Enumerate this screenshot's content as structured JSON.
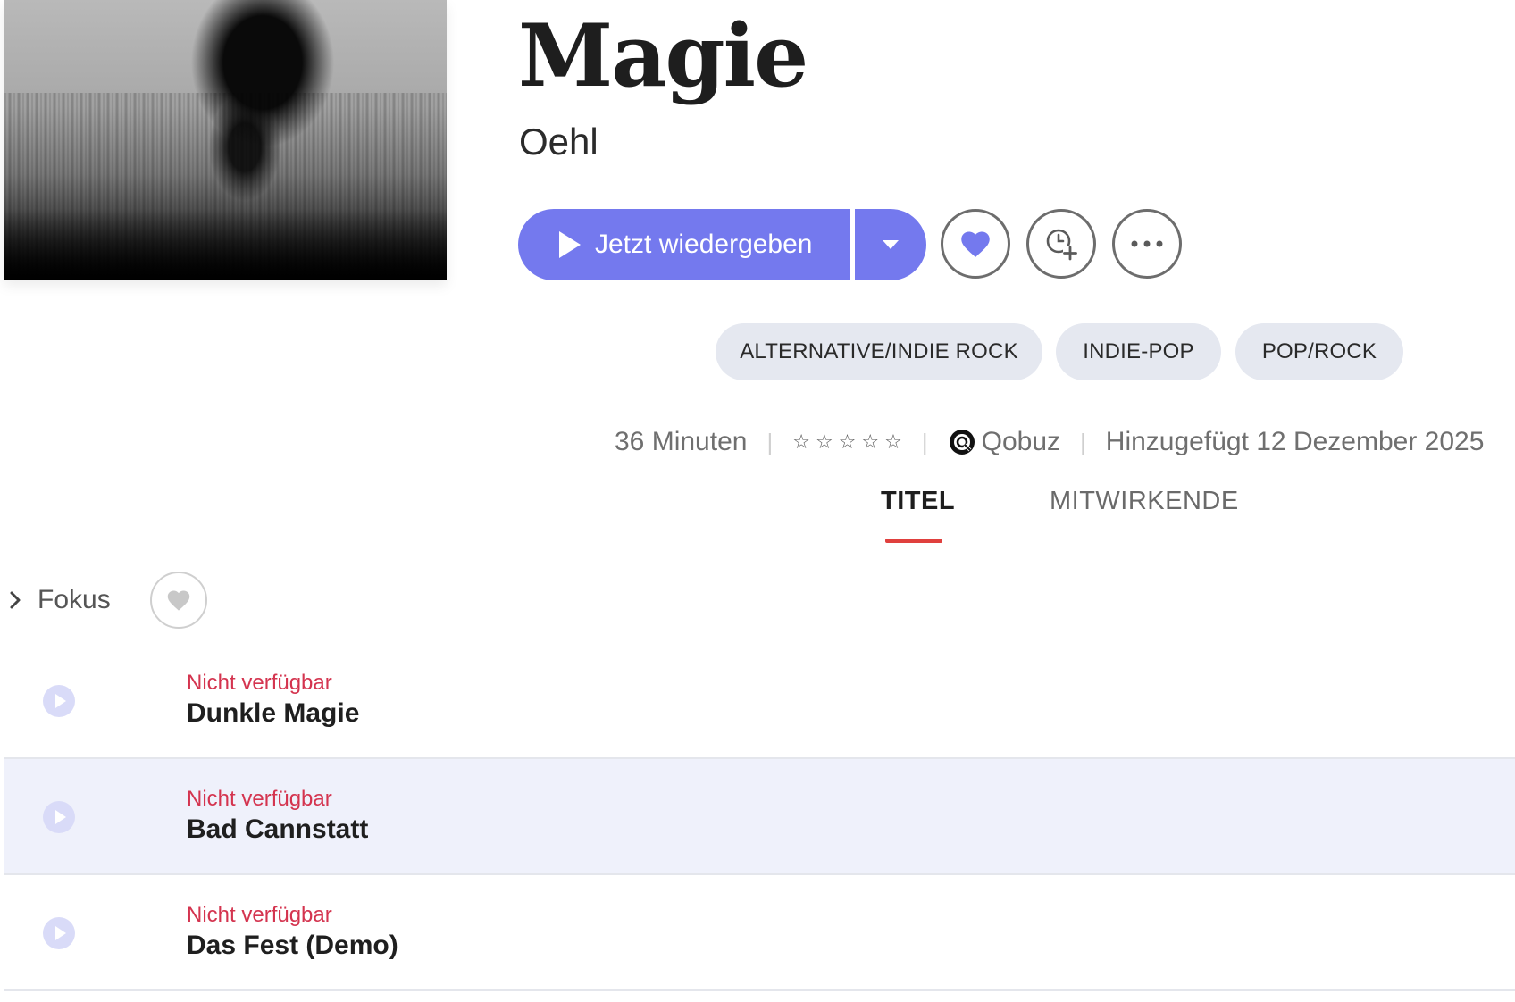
{
  "album": {
    "title": "Magie",
    "artist": "Oehl"
  },
  "actions": {
    "play_label": "Jetzt wiedergeben",
    "accent_color": "#7479ee"
  },
  "genres": [
    "ALTERNATIVE/INDIE ROCK",
    "INDIE-POP",
    "POP/ROCK"
  ],
  "meta": {
    "duration": "36 Minuten",
    "rating_stars": 0,
    "source": "Qobuz",
    "added": "Hinzugefügt 12 Dezember 2025"
  },
  "tabs": [
    {
      "label": "TITEL",
      "active": true
    },
    {
      "label": "MITWIRKENDE",
      "active": false
    }
  ],
  "focus": {
    "label": "Fokus"
  },
  "tracks": [
    {
      "status": "Nicht verfügbar",
      "title": "Dunkle Magie"
    },
    {
      "status": "Nicht verfügbar",
      "title": "Bad Cannstatt"
    },
    {
      "status": "Nicht verfügbar",
      "title": "Das Fest (Demo)"
    }
  ],
  "colors": {
    "tab_underline": "#e0403e",
    "unavailable_text": "#d4344f",
    "chip_background": "#e5e8f0"
  }
}
